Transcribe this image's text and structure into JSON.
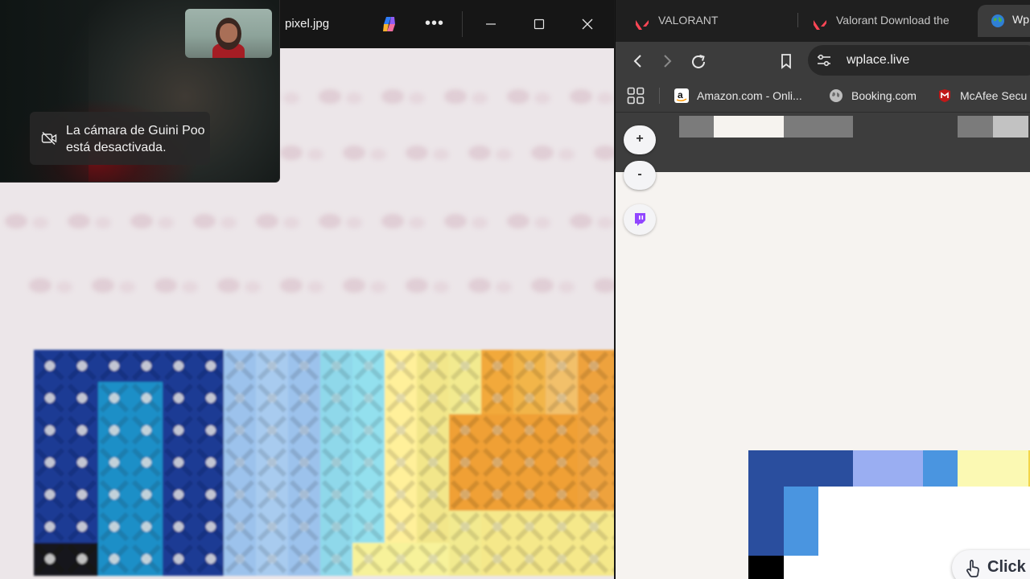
{
  "viewer": {
    "filename": "pixel.jpg",
    "more_label": "•••",
    "icons": {
      "copilot": "copilot-icon",
      "more": "more-icon",
      "minimize": "minimize-icon",
      "maximize": "maximize-icon",
      "close": "close-icon"
    }
  },
  "call": {
    "toast_text": "La cámara de Guini Poo está desactivada.",
    "camera_off_icon": "camera-off-icon"
  },
  "browser": {
    "tabs": [
      {
        "label": "VALORANT",
        "icon": "valorant-icon",
        "active": false
      },
      {
        "label": "Valorant Download the",
        "icon": "valorant-icon",
        "active": false
      },
      {
        "label": "Wp",
        "icon": "globe-icon",
        "active": true
      }
    ],
    "address": "wplace.live",
    "bookmarks": [
      {
        "label": "Amazon.com - Onli...",
        "icon": "amazon-icon"
      },
      {
        "label": "Booking.com",
        "icon": "globe-icon"
      },
      {
        "label": "McAfee Secu",
        "icon": "mcafee-icon"
      }
    ],
    "map": {
      "zoom_in_label": "+",
      "zoom_out_label": "-",
      "click_label": "Click"
    }
  },
  "colors": {
    "valorant_red": "#ff4655",
    "twitch_purple": "#9146ff",
    "mcafee_red": "#c01818",
    "canvas_dark_blue": "#2a4e9e",
    "canvas_light_blue": "#9aaef2",
    "canvas_mid_blue": "#4a95e0",
    "canvas_yellow": "#fbf9b3"
  }
}
